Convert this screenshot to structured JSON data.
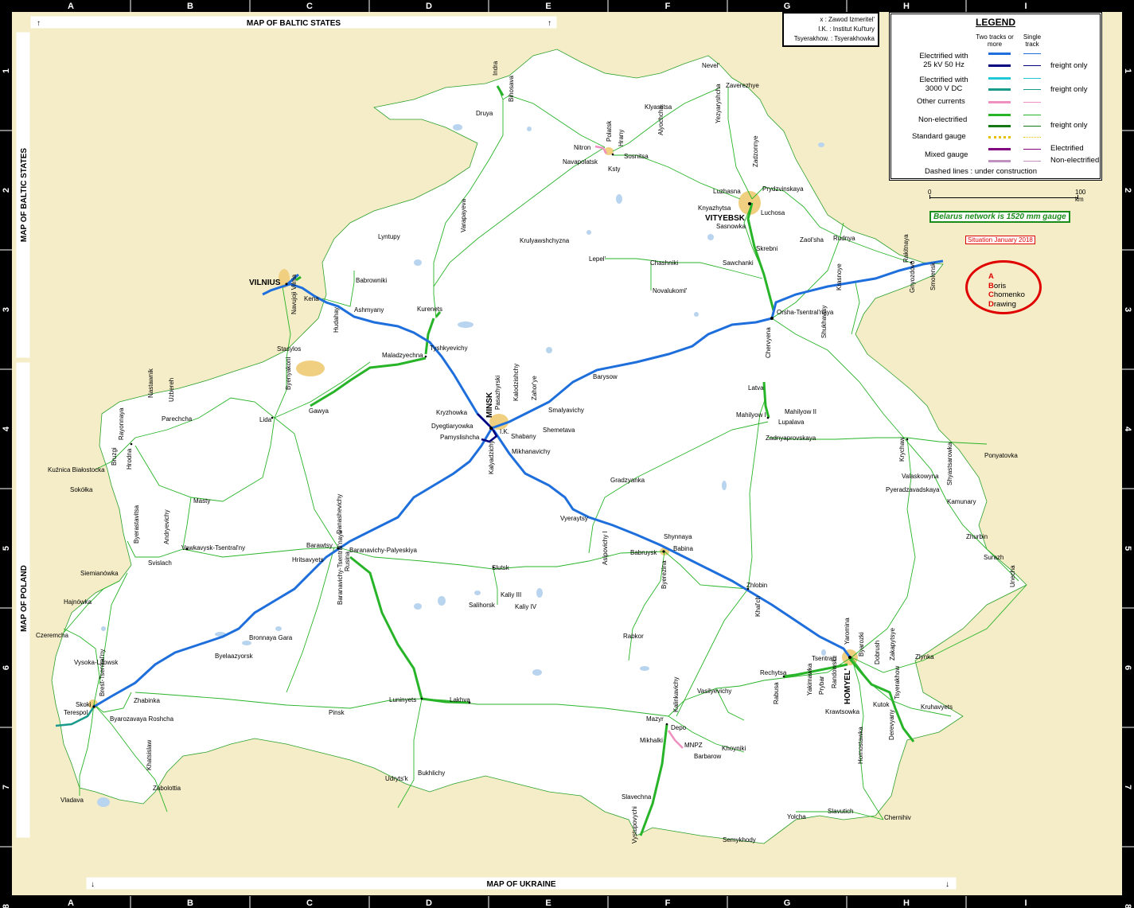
{
  "map": {
    "banners": {
      "top": "MAP OF BALTIC STATES",
      "left_top": "MAP OF BALTIC STATES",
      "left_bottom": "MAP OF POLAND",
      "bottom": "MAP OF UKRAINE"
    },
    "grid": {
      "columns": [
        "A",
        "B",
        "C",
        "D",
        "E",
        "F",
        "G",
        "H",
        "I"
      ],
      "rows": [
        "1",
        "2",
        "3",
        "4",
        "5",
        "6",
        "7",
        "8"
      ]
    },
    "colors": {
      "background": "#f5edc8",
      "country": "#ffffff",
      "frame": "#000000",
      "electrified_25kv": "#1e6fdc",
      "electrified_25kv_freight": "#000080",
      "electrified_3000v": "#20c8d8",
      "electrified_3000v_freight": "#1a9a8a",
      "other_currents": "#f090c0",
      "non_electrified": "#28b428",
      "non_electrified_freight": "#147814",
      "standard_gauge": "#e8c000",
      "mixed_electrified": "#800080",
      "mixed_non_electrified": "#c090c0",
      "water": "#b8d4ee",
      "urban": "#f0d080",
      "accent_red": "#e00000",
      "accent_green": "#1a8c1a"
    },
    "cities_major": [
      "VILNIUS",
      "MINSK",
      "VITYEBSK",
      "HOMYEL'"
    ],
    "places": [
      "Indra",
      "Druya",
      "Bihosava",
      "Nevel'",
      "Zaverezhye",
      "Klyastitsa",
      "Alyochcha",
      "Yezyaryshcha",
      "Nitron",
      "Polatsk",
      "Hrany",
      "Navapolatsk",
      "Sosnitsa",
      "Ksty",
      "Zadzonnye",
      "Luzhasna",
      "Prydzvinskaya",
      "Knyazhytsa",
      "Luchosa",
      "Sasnowka",
      "Varapayeva",
      "Krulyawshchyzna",
      "Lyntupy",
      "Lepel'",
      "Chashniki",
      "Skrebni",
      "Zaol'sha",
      "Rudnya",
      "Rakitnaya",
      "Smolensk",
      "Gnyozdovo",
      "Krasnoye",
      "Sawchanki",
      "Novalukoml'",
      "Babrowniki",
      "Kena",
      "Ashmyany",
      "Navujoji Vilnia",
      "Hudahay",
      "Kurenets",
      "Orsha-Tsentral'naya",
      "Shukhavtsy",
      "Tyshkyevichy",
      "Maladzyechna",
      "Stasylos",
      "Byenyakoni",
      "Barysow",
      "Chervyena",
      "Gawya",
      "Lida",
      "Parechcha",
      "Nastawnik",
      "Uzbereh",
      "Rayonnaya",
      "Hrodna",
      "Bruzgi",
      "Kuźnica Białostocka",
      "Sokółka",
      "Kryzhowka",
      "Dyegtiaryowka",
      "Pamyslishcha",
      "Pasazhyrski",
      "Kalodzishchy",
      "Zahor'ye",
      "Smalyavichy",
      "Shemetava",
      "Shabany",
      "I.K.",
      "Kalyadzichy",
      "Mikhanavichy",
      "Latva",
      "Mahilyow I",
      "Mahilyow II",
      "Lupalava",
      "Zadnyaprovskaya",
      "Krychaw",
      "Ponyatovka",
      "Shyastsarowka",
      "Valaskowyna",
      "Pyeradzavadskaya",
      "Kamunary",
      "Masty",
      "Byerastavitsa",
      "Andryevichy",
      "Vawkavysk-Tsentral'ny",
      "Svislach",
      "Hritsavyets",
      "Barawtsy",
      "Danashevichy",
      "Baranavichy-Palyeskiya",
      "Gradzyanka",
      "Vyeraytsy",
      "Asipovichy I",
      "Shynnaya",
      "Babruysk",
      "Babina",
      "Byerezina",
      "Zhurbin",
      "Surazh",
      "Unecha",
      "Siemianówka",
      "Hajnówka",
      "Czeremcha",
      "Slutsk",
      "Kaliy III",
      "Kaliy IV",
      "Salihorsk",
      "Zhlobin",
      "Khal'ch",
      "Baranavichy-Tsentral'naya",
      "Rusina",
      "Bronnaya Gara",
      "Byelaazyorsk",
      "Rabkor",
      "Vysoka-Litowsk",
      "Brest-Tsentral'ny",
      "Skoki",
      "Terespol",
      "Zhabinka",
      "Byarozavaya Roshcha",
      "Pinsk",
      "Luninyets",
      "Lakhva",
      "Kalinkavichy",
      "Vasilyevichy",
      "Rechytsa",
      "Rabusa",
      "Yakimawka",
      "Prybar",
      "Randowski",
      "Tsentral'l",
      "Yaromina",
      "Byarozki",
      "Dobrush",
      "Zakapytsye",
      "Zlynka",
      "Tsyerakhow",
      "Kruhavyets",
      "Kutok",
      "Krawtsowka",
      "Hornostawka",
      "Derevyany",
      "Mazyr",
      "Depo",
      "Mikhalki",
      "MNPZ",
      "Barbarow",
      "Khoyniki",
      "Khatsislaw",
      "Zabolottia",
      "Vladava",
      "Udryts'k",
      "Bukhlichy",
      "Slavechna",
      "Vystupovychi",
      "Yolcha",
      "Slavutich",
      "Chernihiv",
      "Semykhody"
    ],
    "legend": {
      "title": "LEGEND",
      "col_two": "Two tracks or more",
      "col_single": "Single track",
      "rows": [
        {
          "label": "Electrified with 25 kV 50 Hz",
          "extra": "freight only"
        },
        {
          "label": "Electrified with 3000 V DC",
          "extra": "freight only"
        },
        {
          "label": "Other currents",
          "extra": ""
        },
        {
          "label": "Non-electrified",
          "extra": "freight only"
        },
        {
          "label": "Standard gauge",
          "extra": ""
        },
        {
          "label": "Mixed gauge",
          "extra_top": "Electrified",
          "extra_bottom": "Non-electrified"
        }
      ],
      "dashed_note": "Dashed lines : under construction"
    },
    "abbreviations": [
      "x : Zawod Izmeritel'",
      "I.K. : Institut Kul'tury",
      "Tsyerakhow. : Tsyerakhowka"
    ],
    "scale": {
      "start": "0",
      "end": "100 km"
    },
    "gauge_note": "Belarus network is 1520 mm gauge",
    "situation": "Situation January 2018",
    "credit": [
      {
        "initial": "A",
        "rest": ""
      },
      {
        "initial": "B",
        "rest": "oris"
      },
      {
        "initial": "C",
        "rest": "homenko"
      },
      {
        "initial": "D",
        "rest": "rawing"
      }
    ]
  }
}
